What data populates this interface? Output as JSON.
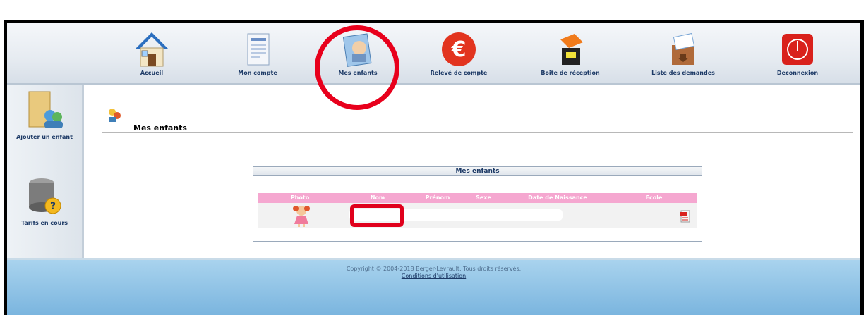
{
  "nav": {
    "items": [
      {
        "label": "Accueil",
        "icon": "home-icon"
      },
      {
        "label": "Mon compte",
        "icon": "account-icon"
      },
      {
        "label": "Mes enfants",
        "icon": "child-photo-icon"
      },
      {
        "label": "Relevé de compte",
        "icon": "euro-icon"
      },
      {
        "label": "Boite de réception",
        "icon": "inbox-icon"
      },
      {
        "label": "Liste des demandes",
        "icon": "requests-box-icon"
      },
      {
        "label": "Deconnexion",
        "icon": "power-icon"
      }
    ]
  },
  "sidebar": {
    "items": [
      {
        "label": "Ajouter un enfant",
        "icon": "add-child-folder-icon"
      },
      {
        "label": "Tarifs en cours",
        "icon": "pricing-database-icon"
      }
    ]
  },
  "main": {
    "title": "Mes enfants",
    "panel_title": "Mes enfants",
    "columns": [
      "Photo",
      "Nom",
      "Prénom",
      "Sexe",
      "Date de Naissance",
      "Ecole"
    ]
  },
  "footer": {
    "copyright": "Copyright © 2004-2018 Berger-Levrault. Tous droits réservés.",
    "terms": "Conditions d'utilisation"
  },
  "colors": {
    "accent_red": "#e8001c",
    "table_header": "#f5a7d0",
    "nav_text": "#1d3a66"
  }
}
